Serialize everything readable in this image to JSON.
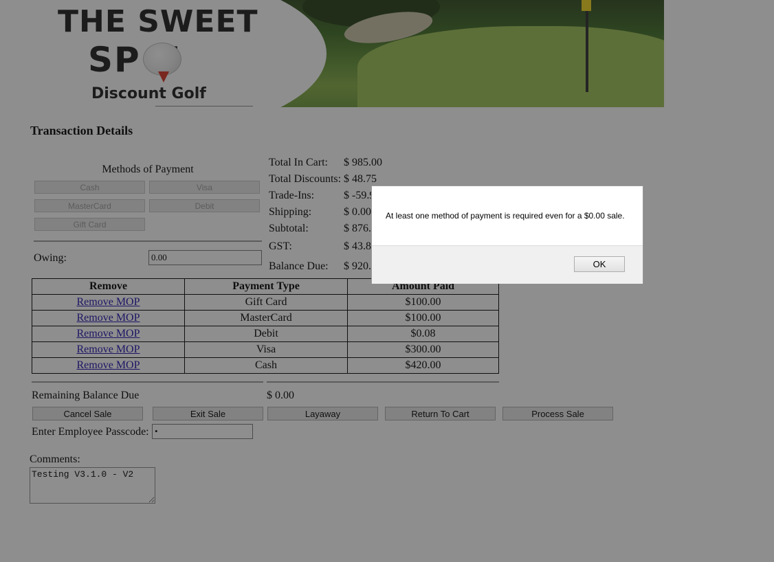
{
  "banner": {
    "logo_line1": "THE SWEET",
    "logo_line2": "SP T",
    "logo_line3": "Discount Golf"
  },
  "page_title": "Transaction Details",
  "methods": {
    "title": "Methods of Payment",
    "buttons": [
      "Cash",
      "Visa",
      "MasterCard",
      "Debit",
      "Gift Card"
    ]
  },
  "owing": {
    "label": "Owing:",
    "value": "0.00"
  },
  "totals": [
    {
      "label": "Total In Cart:",
      "value": "$ 985.00"
    },
    {
      "label": "Total Discounts:",
      "value": "$ 48.75"
    },
    {
      "label": "Trade-Ins:",
      "value": "$ -59.9"
    },
    {
      "label": "Shipping:",
      "value": "$ 0.00"
    },
    {
      "label": "Subtotal:",
      "value": "$ 876."
    },
    {
      "label": "GST:",
      "value": "$ 43.8"
    },
    {
      "label": "Balance Due:",
      "value": "$ 920."
    }
  ],
  "table": {
    "headers": [
      "Remove",
      "Payment Type",
      "Amount Paid"
    ],
    "rows": [
      {
        "remove": "Remove MOP",
        "type": "Gift Card",
        "amount": "$100.00"
      },
      {
        "remove": "Remove MOP",
        "type": "MasterCard",
        "amount": "$100.00"
      },
      {
        "remove": "Remove MOP",
        "type": "Debit",
        "amount": "$0.08"
      },
      {
        "remove": "Remove MOP",
        "type": "Visa",
        "amount": "$300.00"
      },
      {
        "remove": "Remove MOP",
        "type": "Cash",
        "amount": "$420.00"
      }
    ]
  },
  "remaining": {
    "label": "Remaining Balance Due",
    "value": "$ 0.00"
  },
  "actions": [
    "Cancel Sale",
    "Exit Sale",
    "Layaway",
    "Return To Cart",
    "Process Sale"
  ],
  "passcode": {
    "label": "Enter Employee Passcode:",
    "value": "•"
  },
  "comments": {
    "label": "Comments:",
    "value": "Testing V3.1.0 - V2"
  },
  "dialog": {
    "message": "At least one method of payment is required even for a $0.00 sale.",
    "ok_label": "OK"
  }
}
